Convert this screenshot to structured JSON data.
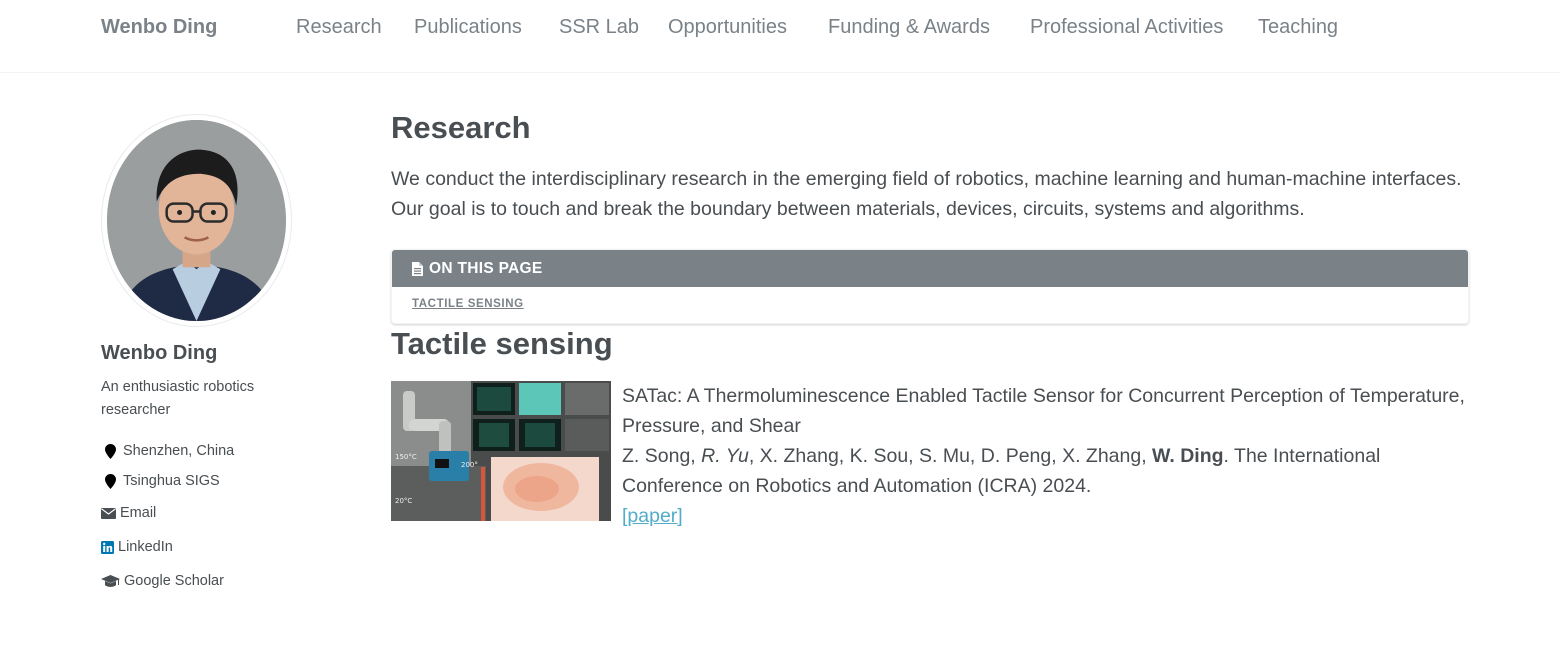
{
  "site": {
    "title": "Wenbo Ding"
  },
  "nav": {
    "items": [
      {
        "label": "Research"
      },
      {
        "label": "Publications"
      },
      {
        "label": "SSR Lab"
      },
      {
        "label": "Opportunities"
      },
      {
        "label": "Funding & Awards"
      },
      {
        "label": "Professional Activities"
      },
      {
        "label": "Teaching"
      }
    ]
  },
  "author": {
    "name": "Wenbo Ding",
    "bio": "An enthusiastic robotics researcher",
    "links": [
      {
        "icon": "map-marker-icon",
        "label": "Shenzhen, China"
      },
      {
        "icon": "map-marker-icon",
        "label": "Tsinghua SIGS"
      },
      {
        "icon": "envelope-icon",
        "label": "Email"
      },
      {
        "icon": "linkedin-icon",
        "label": "LinkedIn",
        "color": "#0077b5"
      },
      {
        "icon": "graduation-cap-icon",
        "label": "Google Scholar"
      }
    ]
  },
  "main": {
    "title": "Research",
    "intro": "We conduct the interdisciplinary research in the emerging field of robotics, machine learning and human-machine interfaces. Our goal is to touch and break the boundary between materials, devices, circuits, systems and algorithms.",
    "toc": {
      "header": "ON THIS PAGE",
      "icon": "file-icon",
      "items": [
        {
          "label": "TACTILE SENSING"
        }
      ]
    },
    "sections": [
      {
        "title": "Tactile sensing",
        "publications": [
          {
            "title": "SATac: A Thermoluminescence Enabled Tactile Sensor for Concurrent Perception of Temperature, Pressure, and Shear",
            "authors_before": "Z. Song, ",
            "author_italic": "R. Yu",
            "authors_middle": ", X. Zhang, K. Sou, S. Mu, D. Peng, X. Zhang, ",
            "author_bold": "W. Ding",
            "venue": ". The International Conference on Robotics and Automation (ICRA) 2024.",
            "link_label": "[paper]",
            "thumb_labels": [
              "150°C",
              "200°",
              "20°C"
            ]
          }
        ]
      }
    ]
  },
  "colors": {
    "link": "#52adc8",
    "nav": "#7a8288",
    "text": "#494e52",
    "toc_header_bg": "#7a8288"
  }
}
